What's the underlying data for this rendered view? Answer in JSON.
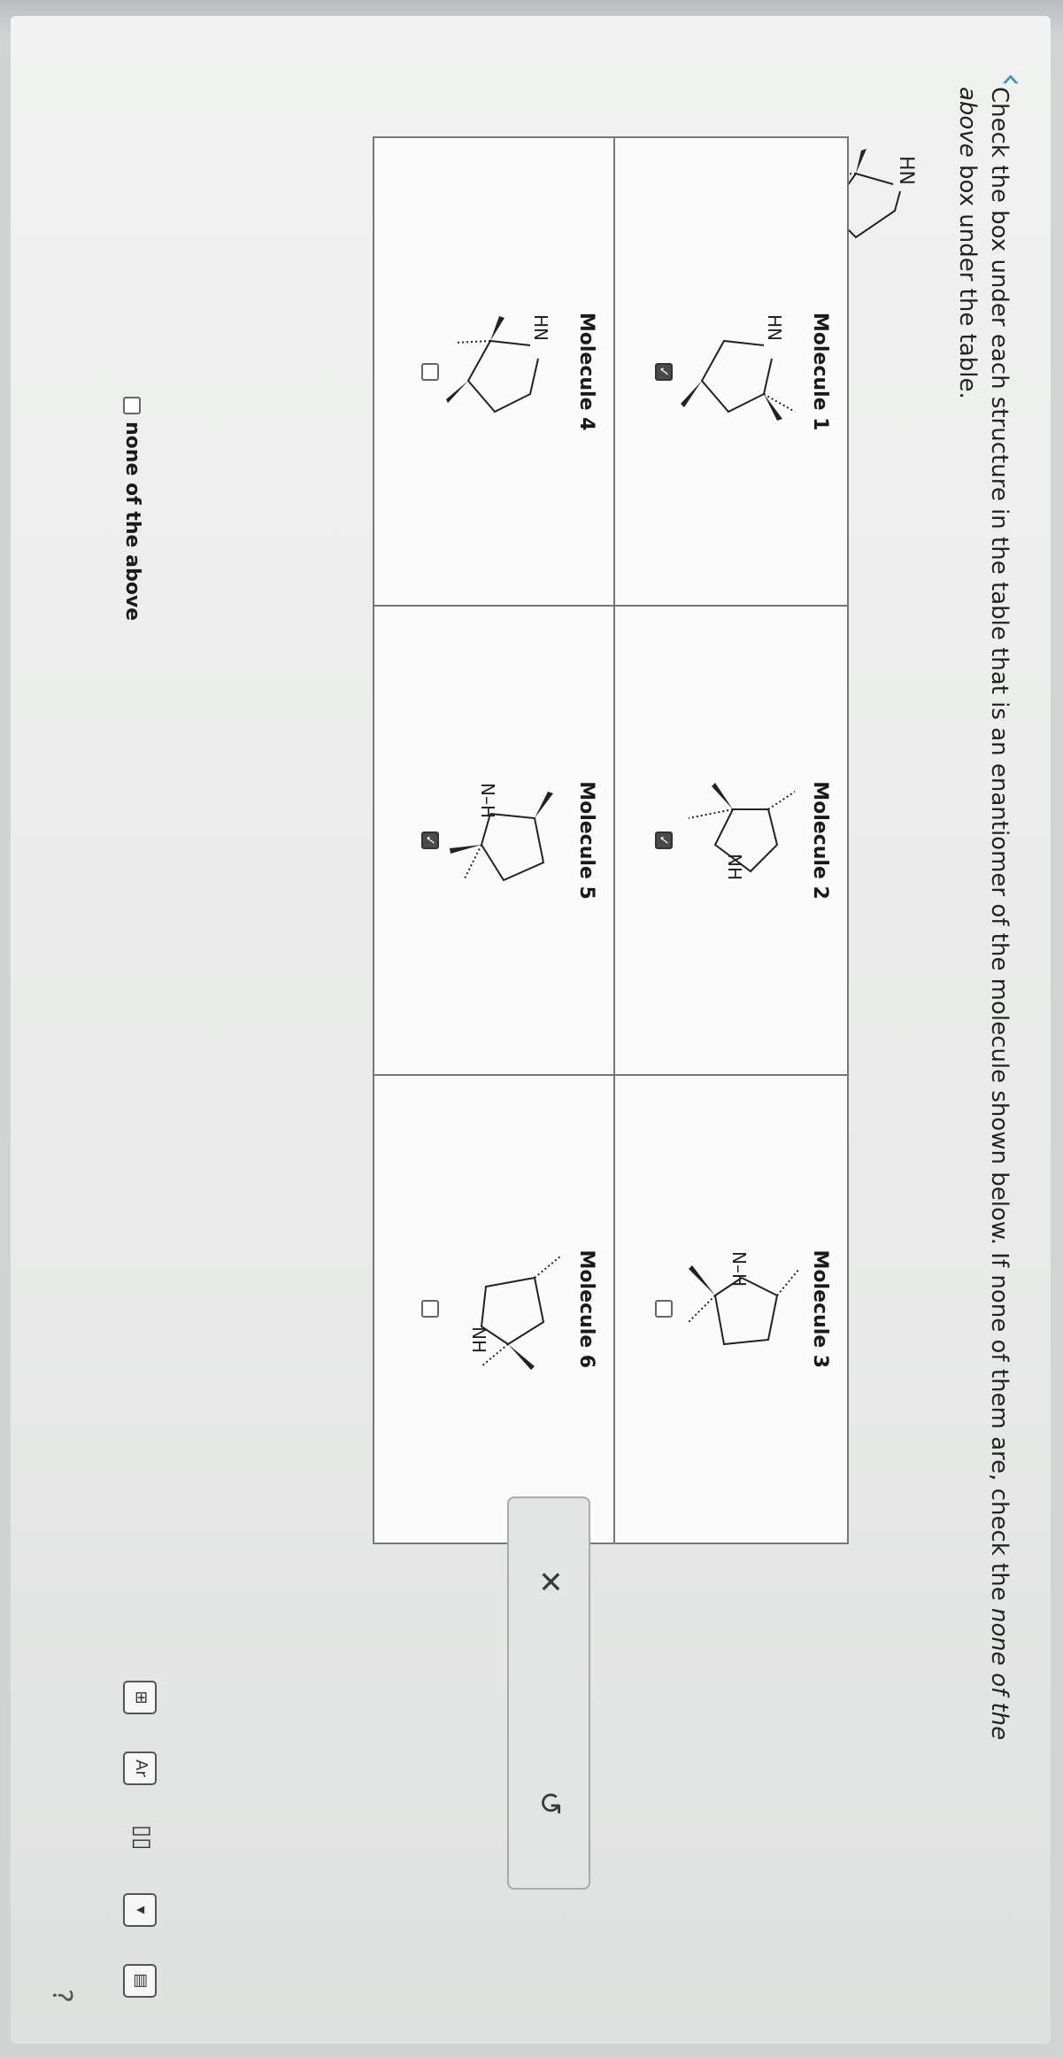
{
  "question": {
    "text_before": "Check the box under each structure in the table that is an enantiomer of the molecule shown below. If none of them are, check the ",
    "emphasis": "none of the above",
    "text_after": " box under the table."
  },
  "reference_molecule": {
    "label": "HN"
  },
  "molecules": [
    {
      "title": "Molecule 1",
      "nlabel": "HN",
      "checked": true
    },
    {
      "title": "Molecule 2",
      "nlabel": "NH",
      "checked": true
    },
    {
      "title": "Molecule 3",
      "nlabel": "N–H",
      "checked": false
    },
    {
      "title": "Molecule 4",
      "nlabel": "HN",
      "checked": false
    },
    {
      "title": "Molecule 5",
      "nlabel": "N–H",
      "checked": true
    },
    {
      "title": "Molecule 6",
      "nlabel": "NH",
      "checked": false
    }
  ],
  "none_of_above": {
    "label": "none of the above",
    "checked": false
  },
  "actions": {
    "clear_symbol": "✕",
    "undo_symbol": "↺"
  },
  "toolbar": {
    "help": "?",
    "check_mark": "✓"
  }
}
